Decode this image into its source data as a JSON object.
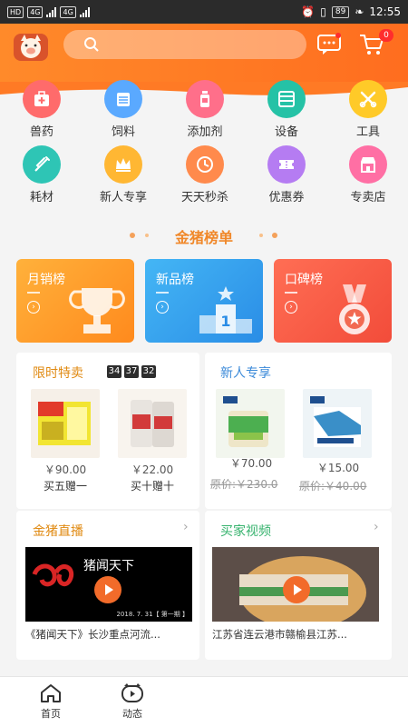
{
  "status_bar": {
    "network_tags": [
      "HD",
      "4G",
      "4G"
    ],
    "battery": "89",
    "time": "12:55"
  },
  "header": {
    "cart_badge": "0"
  },
  "categories": [
    {
      "label": "兽药",
      "icon": "medicine-box-icon",
      "color": "#ff6b6b"
    },
    {
      "label": "饲料",
      "icon": "feed-bag-icon",
      "color": "#5aa9ff"
    },
    {
      "label": "添加剂",
      "icon": "bottle-icon",
      "color": "#ff6f8a"
    },
    {
      "label": "设备",
      "icon": "equipment-icon",
      "color": "#25c2a6"
    },
    {
      "label": "工具",
      "icon": "tools-icon",
      "color": "#ffca28"
    },
    {
      "label": "耗材",
      "icon": "syringe-icon",
      "color": "#2ec5b5"
    },
    {
      "label": "新人专享",
      "icon": "crown-icon",
      "color": "#ffb733"
    },
    {
      "label": "天天秒杀",
      "icon": "clock-icon",
      "color": "#ff8a4c"
    },
    {
      "label": "优惠券",
      "icon": "coupon-icon",
      "color": "#b57cf2"
    },
    {
      "label": "专卖店",
      "icon": "store-icon",
      "color": "#ff6fa4"
    }
  ],
  "ranking": {
    "title": "金猪榜单",
    "cards": [
      {
        "label": "月销榜",
        "icon": "trophy-icon"
      },
      {
        "label": "新品榜",
        "icon": "podium-icon"
      },
      {
        "label": "口碑榜",
        "icon": "medal-icon"
      }
    ]
  },
  "flash_sale": {
    "title": "限时特卖",
    "timer": [
      "34",
      "37",
      "32"
    ],
    "items": [
      {
        "price": "￥90.00",
        "promo": "买五赠一"
      },
      {
        "price": "￥22.00",
        "promo": "买十赠十"
      }
    ]
  },
  "newcomer": {
    "title": "新人专享",
    "items": [
      {
        "price": "￥70.00",
        "original": "原价:￥230.0"
      },
      {
        "price": "￥15.00",
        "original": "原价:￥40.00"
      }
    ]
  },
  "live": {
    "title": "金猪直播",
    "video_overlay": "猪闻天下",
    "video_date": "2018. 7. 31【 第一期 】",
    "caption": "《猪闻天下》长沙重点河流..."
  },
  "buyer_video": {
    "title": "买家视频",
    "caption": "江苏省连云港市赣榆县江苏..."
  },
  "bottom_nav": [
    {
      "label": "首页",
      "icon": "home-icon"
    },
    {
      "label": "动态",
      "icon": "feed-icon"
    }
  ],
  "colors": {
    "brand_orange": "#ff7a25",
    "title_orange": "#f0882a",
    "live_title": "#e08a12",
    "newcomer_title": "#3b8ad9",
    "video_title": "#37b36e"
  }
}
